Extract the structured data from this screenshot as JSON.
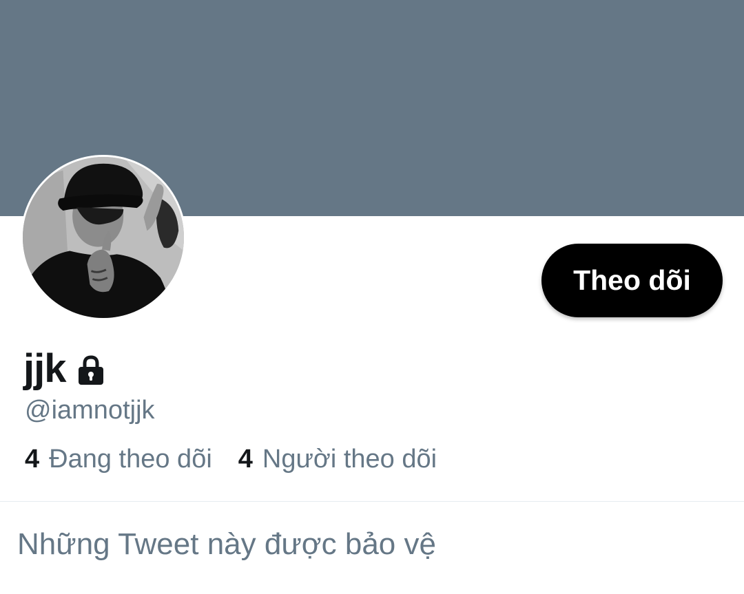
{
  "profile": {
    "display_name": "jjk",
    "handle": "@iamnotjjk",
    "locked_icon": "lock-icon",
    "follow_button_label": "Theo dõi",
    "stats": {
      "following_count": "4",
      "following_label": "Đang theo dõi",
      "followers_count": "4",
      "followers_label": "Người theo dõi"
    }
  },
  "tweets": {
    "protected_message": "Những Tweet này được bảo vệ"
  },
  "colors": {
    "banner": "#657786",
    "primary_text": "#14171a",
    "secondary_text": "#657786",
    "button_bg": "#000000",
    "button_text": "#ffffff"
  }
}
